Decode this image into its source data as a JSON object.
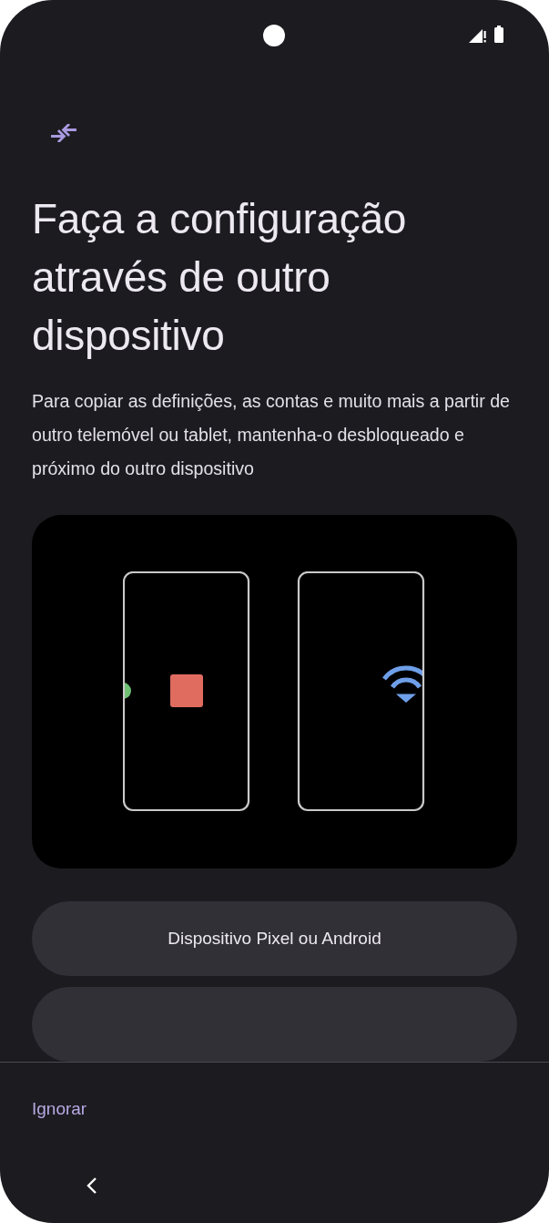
{
  "title": "Faça a configuração através de outro dispositivo",
  "description": "Para copiar as definições, as contas e muito mais a partir de outro telemóvel ou tablet, mantenha-o desbloqueado e próximo do outro dispositivo",
  "options": [
    "Dispositivo Pixel ou Android"
  ],
  "skip_button": "Ignorar"
}
